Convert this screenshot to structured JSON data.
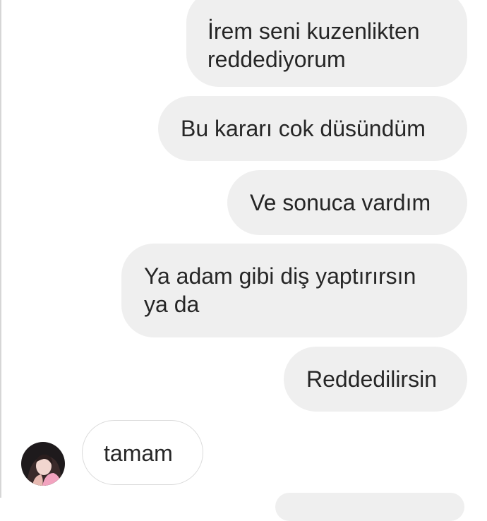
{
  "messages": [
    {
      "side": "sent",
      "text": "İrem seni kuzenlikten\nreddediyorum"
    },
    {
      "side": "sent",
      "text": "Bu kararı cok düsündüm"
    },
    {
      "side": "sent",
      "text": "Ve sonuca vardım"
    },
    {
      "side": "sent",
      "text": "Ya adam gibi diş yaptırırsın\nya da"
    },
    {
      "side": "sent",
      "text": "Reddedilirsin"
    },
    {
      "side": "received",
      "text": "tamam"
    }
  ],
  "avatar": {
    "icon": "profile-photo"
  }
}
